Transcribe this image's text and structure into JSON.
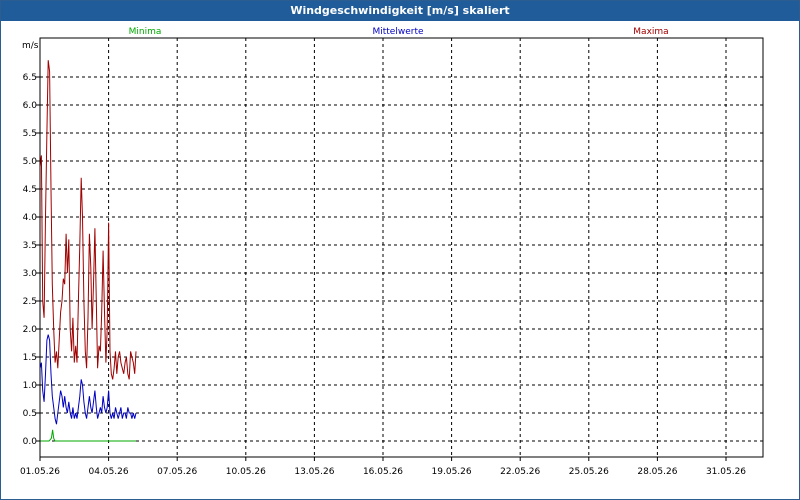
{
  "window": {
    "title": "Windgeschwindigkeit [m/s] skaliert"
  },
  "chart_data": {
    "type": "line",
    "title": "Windgeschwindigkeit [m/s] skaliert",
    "ylabel": "m/s",
    "xlabel": "",
    "ylim": [
      0,
      7.0
    ],
    "xlim": [
      "01.05.26",
      "02.06.26"
    ],
    "grid": true,
    "y_ticks": [
      "0.0",
      "0.5",
      "1.0",
      "1.5",
      "2.0",
      "2.5",
      "3.0",
      "3.5",
      "4.0",
      "4.5",
      "5.0",
      "5.5",
      "6.0",
      "6.5"
    ],
    "x_ticks": [
      "01.05.26",
      "04.05.26",
      "07.05.26",
      "10.05.26",
      "13.05.26",
      "16.05.26",
      "19.05.26",
      "22.05.26",
      "25.05.26",
      "28.05.26",
      "31.05.26"
    ],
    "legend": [
      "Minima",
      "Mittelwerte",
      "Maxima"
    ],
    "legend_position": "top",
    "colors": {
      "Minima": "#00aa00",
      "Mittelwerte": "#0000c0",
      "Maxima": "#a00000"
    },
    "series": [
      {
        "name": "Maxima",
        "color": "#a00000",
        "x": [
          1.0,
          1.06,
          1.12,
          1.18,
          1.24,
          1.3,
          1.36,
          1.42,
          1.48,
          1.54,
          1.6,
          1.66,
          1.72,
          1.78,
          1.84,
          1.9,
          1.96,
          2.02,
          2.08,
          2.14,
          2.2,
          2.26,
          2.32,
          2.38,
          2.44,
          2.5,
          2.56,
          2.62,
          2.68,
          2.74,
          2.8,
          2.86,
          2.92,
          2.98,
          3.04,
          3.1,
          3.16,
          3.22,
          3.28,
          3.34,
          3.4,
          3.46,
          3.52,
          3.58,
          3.64,
          3.7,
          3.76,
          3.82,
          3.88,
          3.94,
          4.0,
          4.06,
          4.12,
          4.18,
          4.24,
          4.3,
          4.36,
          4.42,
          4.48,
          4.54,
          4.6,
          4.66,
          4.72,
          4.78,
          4.84,
          4.9,
          4.96,
          5.02,
          5.08,
          5.14,
          5.2
        ],
        "values": [
          4.9,
          5.1,
          2.5,
          2.2,
          4.0,
          5.5,
          6.8,
          6.6,
          4.5,
          2.8,
          2.0,
          1.4,
          1.6,
          1.3,
          1.8,
          2.3,
          2.5,
          2.9,
          2.8,
          3.7,
          3.0,
          3.6,
          2.0,
          1.6,
          2.2,
          1.4,
          1.7,
          1.4,
          2.5,
          3.5,
          4.7,
          4.0,
          2.5,
          1.6,
          1.3,
          2.2,
          3.7,
          3.1,
          2.0,
          2.8,
          3.8,
          2.5,
          1.3,
          1.7,
          1.6,
          2.3,
          3.4,
          2.3,
          1.4,
          2.0,
          3.9,
          1.6,
          1.2,
          1.1,
          1.3,
          1.6,
          1.2,
          1.5,
          1.6,
          1.4,
          1.3,
          1.2,
          1.4,
          1.5,
          1.2,
          1.1,
          1.6,
          1.5,
          1.4,
          1.2,
          1.6
        ]
      },
      {
        "name": "Mittelwerte",
        "color": "#0000c0",
        "x": [
          1.0,
          1.06,
          1.12,
          1.18,
          1.24,
          1.3,
          1.36,
          1.42,
          1.48,
          1.54,
          1.6,
          1.66,
          1.72,
          1.78,
          1.84,
          1.9,
          1.96,
          2.02,
          2.08,
          2.14,
          2.2,
          2.26,
          2.32,
          2.38,
          2.44,
          2.5,
          2.56,
          2.62,
          2.68,
          2.74,
          2.8,
          2.86,
          2.92,
          2.98,
          3.04,
          3.1,
          3.16,
          3.22,
          3.28,
          3.34,
          3.4,
          3.46,
          3.52,
          3.58,
          3.64,
          3.7,
          3.76,
          3.82,
          3.88,
          3.94,
          4.0,
          4.06,
          4.12,
          4.18,
          4.24,
          4.3,
          4.36,
          4.42,
          4.48,
          4.54,
          4.6,
          4.66,
          4.72,
          4.78,
          4.84,
          4.9,
          4.96,
          5.02,
          5.08,
          5.14,
          5.2
        ],
        "values": [
          1.3,
          1.4,
          0.9,
          0.7,
          1.2,
          1.8,
          1.9,
          1.8,
          1.2,
          0.8,
          0.6,
          0.4,
          0.3,
          0.5,
          0.7,
          0.9,
          0.8,
          0.6,
          0.8,
          0.6,
          0.5,
          0.7,
          0.5,
          0.4,
          0.6,
          0.4,
          0.5,
          0.4,
          0.6,
          0.8,
          1.1,
          1.0,
          0.7,
          0.5,
          0.4,
          0.6,
          0.8,
          0.6,
          0.5,
          0.7,
          0.9,
          0.6,
          0.4,
          0.5,
          0.6,
          0.5,
          0.8,
          0.6,
          0.5,
          0.6,
          0.9,
          0.5,
          0.4,
          0.5,
          0.4,
          0.6,
          0.5,
          0.4,
          0.5,
          0.6,
          0.4,
          0.5,
          0.5,
          0.4,
          0.6,
          0.5,
          0.5,
          0.4,
          0.5,
          0.4,
          0.5
        ]
      },
      {
        "name": "Minima",
        "color": "#00aa00",
        "x": [
          1.0,
          1.2,
          1.4,
          1.5,
          1.55,
          1.6,
          1.65,
          1.75,
          2.0,
          3.0,
          4.0,
          5.0,
          5.2
        ],
        "values": [
          0.0,
          0.0,
          0.0,
          0.05,
          0.2,
          0.05,
          0.0,
          0.0,
          0.0,
          0.0,
          0.0,
          0.0,
          0.0
        ]
      }
    ]
  }
}
